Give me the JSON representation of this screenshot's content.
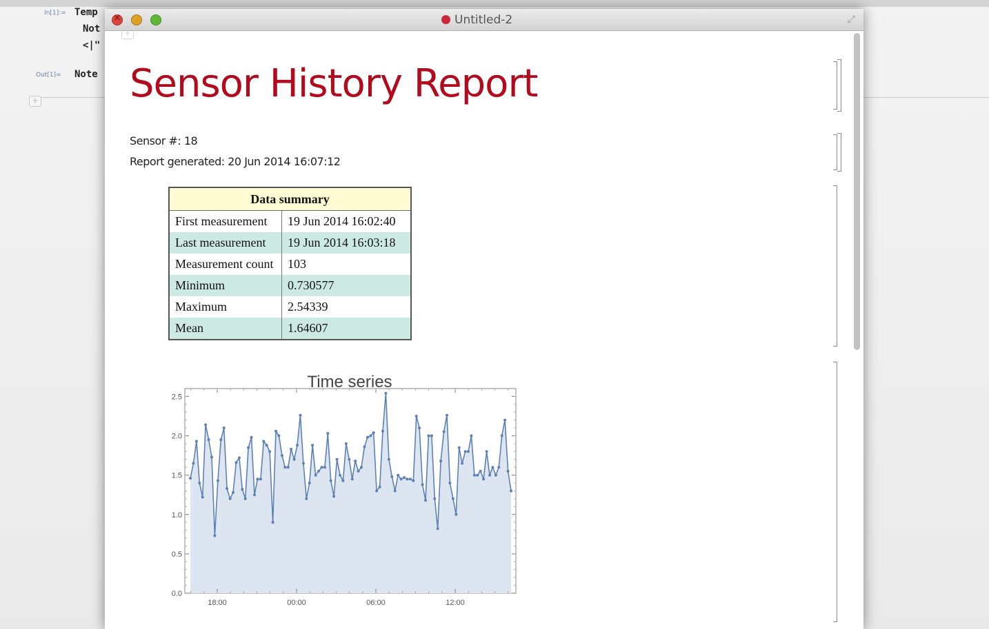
{
  "background_notebook": {
    "in_label": "In[1]:=",
    "out_label": "Out[1]=",
    "lines": [
      "Temp",
      "Not",
      "<|\"",
      "Note"
    ]
  },
  "window": {
    "title": "Untitled-2"
  },
  "report": {
    "title": "Sensor History Report",
    "sensor_line": "Sensor #: 18",
    "generated_line": "Report generated: 20 Jun 2014 16:07:12"
  },
  "summary": {
    "header": "Data summary",
    "rows": [
      {
        "label": "First measurement",
        "value": "19 Jun 2014 16:02:40"
      },
      {
        "label": "Last measurement",
        "value": "19 Jun 2014 16:03:18"
      },
      {
        "label": "Measurement count",
        "value": "103"
      },
      {
        "label": "Minimum",
        "value": "0.730577"
      },
      {
        "label": "Maximum",
        "value": "2.54339"
      },
      {
        "label": "Mean",
        "value": "1.64607"
      }
    ]
  },
  "chart_data": {
    "type": "area",
    "title": "Time series",
    "xlabel": "",
    "ylabel": "",
    "x_tick_labels": [
      "18:00",
      "00:00",
      "06:00",
      "12:00"
    ],
    "y_tick_labels": [
      "0.0",
      "0.5",
      "1.0",
      "1.5",
      "2.0",
      "2.5"
    ],
    "ylim": [
      0,
      2.6
    ],
    "series": [
      {
        "values": [
          1.46,
          1.65,
          1.93,
          1.4,
          1.22,
          2.14,
          1.95,
          1.73,
          0.73,
          1.43,
          1.95,
          2.1,
          1.33,
          1.2,
          1.28,
          1.66,
          1.72,
          1.32,
          1.2,
          1.85,
          1.98,
          1.25,
          1.45,
          1.45,
          1.93,
          1.88,
          1.8,
          0.9,
          2.06,
          2.0,
          1.75,
          1.6,
          1.6,
          1.83,
          1.7,
          1.88,
          2.26,
          1.65,
          1.2,
          1.4,
          1.88,
          1.5,
          1.55,
          1.6,
          1.6,
          2.03,
          1.43,
          1.23,
          1.7,
          1.5,
          1.43,
          1.9,
          1.7,
          1.45,
          1.68,
          1.55,
          1.6,
          1.86,
          1.98,
          2.0,
          2.04,
          1.3,
          1.35,
          2.06,
          2.54,
          1.7,
          1.48,
          1.3,
          1.5,
          1.45,
          1.47,
          1.45,
          1.45,
          1.43,
          2.25,
          2.1,
          1.38,
          1.18,
          2.0,
          2.0,
          1.2,
          0.82,
          1.68,
          2.05,
          2.26,
          1.4,
          1.2,
          1.0,
          1.85,
          1.65,
          1.8,
          1.8,
          2.0,
          1.5,
          1.5,
          1.55,
          1.45,
          1.8,
          1.5,
          1.6,
          1.5,
          1.6,
          2.0,
          2.2,
          1.55,
          1.3
        ]
      }
    ],
    "colors": {
      "line": "#5e81b5",
      "fill": "#dce5f0"
    }
  }
}
